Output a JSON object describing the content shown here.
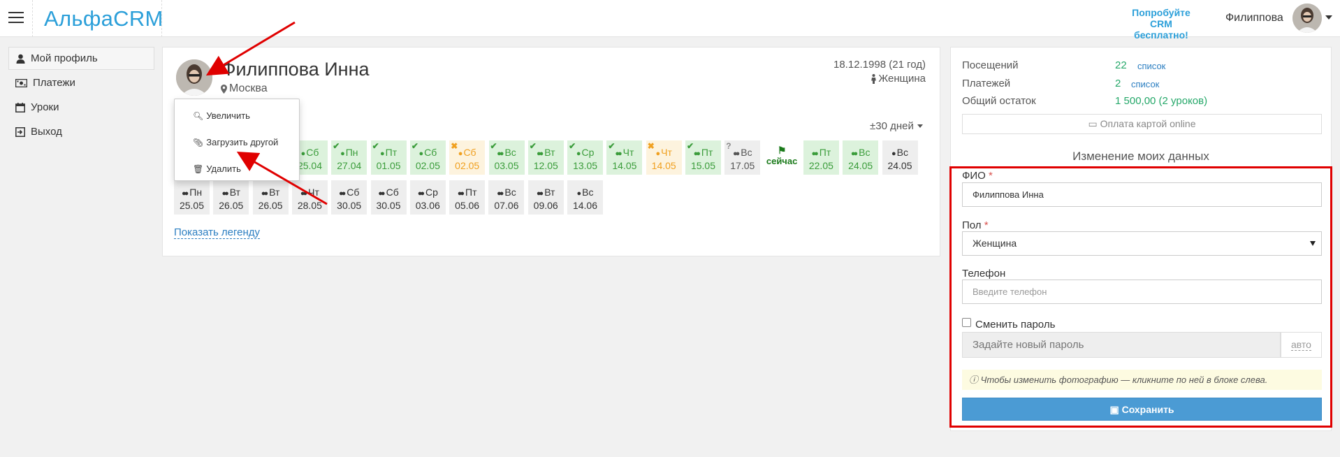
{
  "header": {
    "logo": "АльфаCRM",
    "promo_line1": "Попробуйте",
    "promo_line2": "CRM бесплатно!",
    "user_name": "Филиппова"
  },
  "sidebar": {
    "items": [
      {
        "label": "Мой профиль",
        "icon": "user-icon",
        "active": true
      },
      {
        "label": "Платежи",
        "icon": "money-icon"
      },
      {
        "label": "Уроки",
        "icon": "calendar-icon"
      },
      {
        "label": "Выход",
        "icon": "logout-icon"
      }
    ]
  },
  "profile": {
    "name": "Филиппова Инна",
    "city": "Москва",
    "birth": "18.12.1998 (21 год)",
    "gender": "Женщина",
    "range_label": "±30 дней",
    "legend_link": "Показать легенду"
  },
  "photo_menu": {
    "zoom": "Увеличить",
    "upload": "Загрузить другой",
    "delete": "Удалить"
  },
  "calendar": {
    "row1": [
      {
        "dow": "Сб",
        "date": "25.04",
        "status": "green",
        "icon": "person"
      },
      {
        "dow": "Пн",
        "date": "27.04",
        "status": "green",
        "icon": "person",
        "mark": "check"
      },
      {
        "dow": "Пт",
        "date": "01.05",
        "status": "green",
        "icon": "person",
        "mark": "check"
      },
      {
        "dow": "Сб",
        "date": "02.05",
        "status": "green",
        "icon": "person",
        "mark": "check"
      },
      {
        "dow": "Сб",
        "date": "02.05",
        "status": "orange",
        "icon": "person",
        "mark": "cross"
      },
      {
        "dow": "Вс",
        "date": "03.05",
        "status": "green",
        "icon": "group",
        "mark": "check"
      },
      {
        "dow": "Вт",
        "date": "12.05",
        "status": "green",
        "icon": "group",
        "mark": "check"
      },
      {
        "dow": "Ср",
        "date": "13.05",
        "status": "green",
        "icon": "person",
        "mark": "check"
      },
      {
        "dow": "Чт",
        "date": "14.05",
        "status": "green",
        "icon": "group",
        "mark": "check"
      },
      {
        "dow": "Чт",
        "date": "14.05",
        "status": "orange",
        "icon": "person",
        "mark": "cross"
      },
      {
        "dow": "Пт",
        "date": "15.05",
        "status": "green",
        "icon": "group",
        "mark": "check"
      },
      {
        "dow": "Вс",
        "date": "17.05",
        "status": "grey",
        "icon": "group",
        "mark": "question"
      },
      {
        "now": true,
        "label": "сейчас"
      },
      {
        "dow": "Пт",
        "date": "22.05",
        "status": "green",
        "icon": "group"
      },
      {
        "dow": "Вс",
        "date": "24.05",
        "status": "green",
        "icon": "group"
      },
      {
        "dow": "Вс",
        "date": "24.05",
        "status": "dark",
        "icon": "person"
      }
    ],
    "row2": [
      {
        "dow": "Пн",
        "date": "25.05",
        "status": "dark",
        "icon": "group"
      },
      {
        "dow": "Вт",
        "date": "26.05",
        "status": "dark",
        "icon": "group"
      },
      {
        "dow": "Вт",
        "date": "26.05",
        "status": "dark",
        "icon": "group"
      },
      {
        "dow": "Чт",
        "date": "28.05",
        "status": "dark",
        "icon": "group"
      },
      {
        "dow": "Сб",
        "date": "30.05",
        "status": "dark",
        "icon": "group"
      },
      {
        "dow": "Сб",
        "date": "30.05",
        "status": "dark",
        "icon": "group"
      },
      {
        "dow": "Ср",
        "date": "03.06",
        "status": "dark",
        "icon": "group"
      },
      {
        "dow": "Пт",
        "date": "05.06",
        "status": "dark",
        "icon": "group"
      },
      {
        "dow": "Вс",
        "date": "07.06",
        "status": "dark",
        "icon": "group"
      },
      {
        "dow": "Вт",
        "date": "09.06",
        "status": "dark",
        "icon": "group"
      },
      {
        "dow": "Вс",
        "date": "14.06",
        "status": "dark",
        "icon": "person"
      }
    ]
  },
  "stats": {
    "visits_label": "Посещений",
    "visits_value": "22",
    "visits_link": "список",
    "payments_label": "Платежей",
    "payments_value": "2",
    "payments_link": "список",
    "balance_label": "Общий остаток",
    "balance_value": "1 500,00 (2 уроков)",
    "pay_online": "Оплата картой online"
  },
  "form": {
    "title": "Изменение моих данных",
    "fio_label": "ФИО",
    "fio_value": "Филиппова Инна",
    "gender_label": "Пол",
    "gender_value": "Женщина",
    "phone_label": "Телефон",
    "phone_placeholder": "Введите телефон",
    "change_password_label": "Сменить пароль",
    "password_placeholder": "Задайте новый пароль",
    "auto_label": "авто",
    "hint": "Чтобы изменить фотографию — кликните по ней в блоке слева.",
    "save_label": "Сохранить",
    "required_mark": "*"
  },
  "colors": {
    "accent": "#2b9fd9",
    "save": "#4b9bd4",
    "annotation": "#e00000",
    "green": "#26a86a"
  }
}
